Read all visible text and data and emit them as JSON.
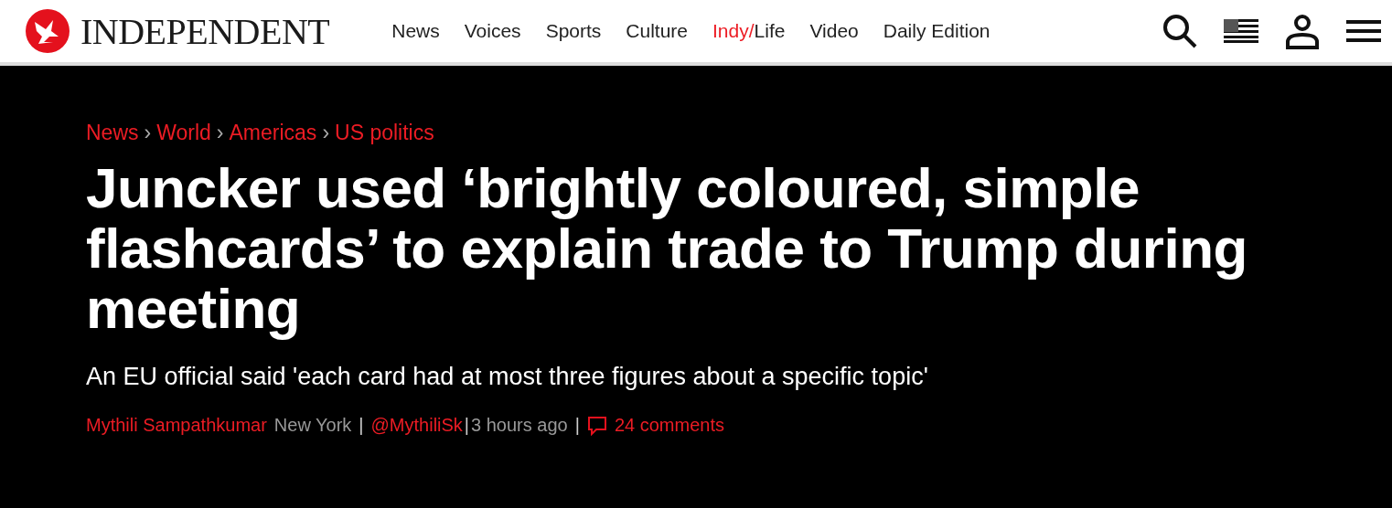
{
  "header": {
    "logo": "INDEPENDENT",
    "nav": [
      {
        "label": "News"
      },
      {
        "label": "Voices"
      },
      {
        "label": "Sports"
      },
      {
        "label": "Culture"
      },
      {
        "prefix": "Indy/",
        "label": "Life"
      },
      {
        "label": "Video"
      },
      {
        "label": "Daily Edition"
      }
    ]
  },
  "article": {
    "breadcrumbs": [
      "News",
      "World",
      "Americas",
      "US politics"
    ],
    "breadcrumb_separator": "›",
    "headline": "Juncker used ‘brightly coloured, simple flashcards’ to explain trade to Trump during meeting",
    "standfirst": "An EU official said 'each card had at most three figures about a specific topic'",
    "author": "Mythili Sampathkumar",
    "location": "New York",
    "separator": "|",
    "twitter": "@MythiliSk",
    "time": "3 hours ago",
    "comments": "24 comments"
  }
}
